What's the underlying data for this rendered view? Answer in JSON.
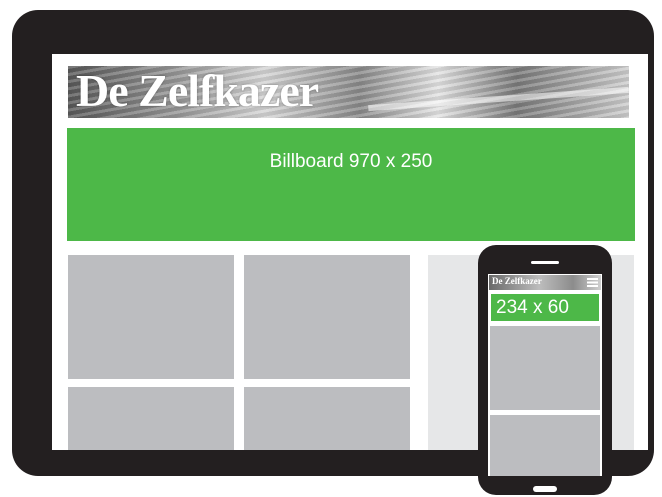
{
  "tablet": {
    "masthead": {
      "logo_text": "De Zelfkazer"
    },
    "billboard": {
      "label": "Billboard 970 x 250",
      "color": "#4db848"
    },
    "content_tile_color": "#bcbdc0",
    "sidebar_color": "#e6e7e8"
  },
  "phone": {
    "masthead": {
      "logo_text": "De Zelfkazer",
      "icon": "menu-icon"
    },
    "ad": {
      "label": "234 x 60",
      "color": "#4db848"
    }
  },
  "device_color": "#231f20"
}
